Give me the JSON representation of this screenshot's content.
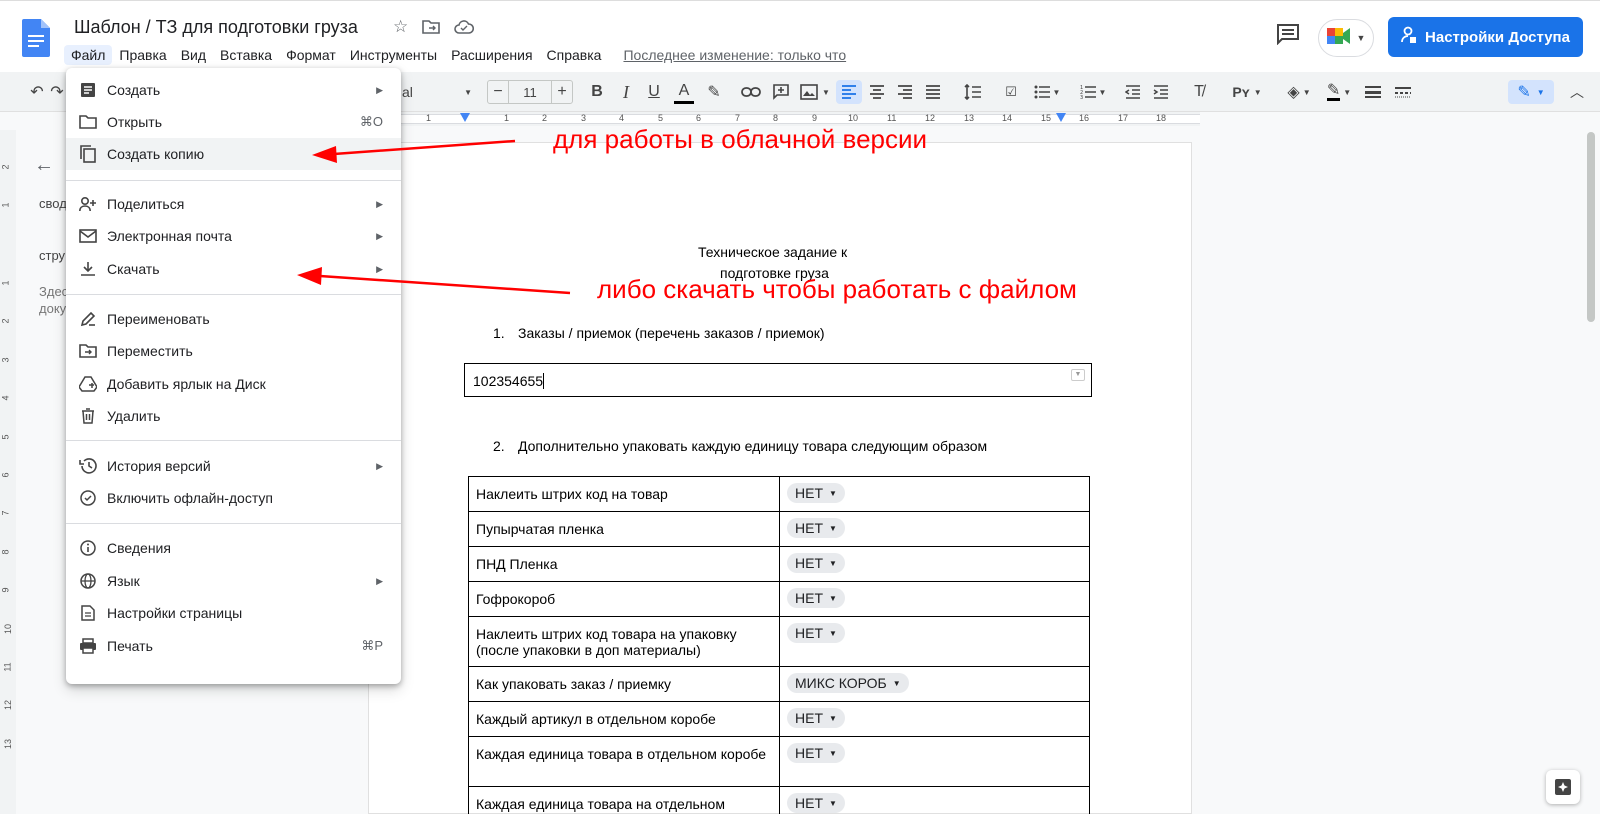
{
  "document": {
    "title": "Шаблон / ТЗ для подготовки груза"
  },
  "menubar": {
    "items": [
      "Файл",
      "Правка",
      "Вид",
      "Вставка",
      "Формат",
      "Инструменты",
      "Расширения",
      "Справка"
    ],
    "last_edit": "Последнее изменение: только что"
  },
  "header": {
    "share_label": "Настройки Доступа",
    "share_color": "#1a73e8"
  },
  "toolbar": {
    "font_name": "al",
    "font_size": "11",
    "minus": "−",
    "plus": "+"
  },
  "ruler": {
    "numbers": [
      "1",
      "1",
      "2",
      "3",
      "4",
      "5",
      "6",
      "7",
      "8",
      "9",
      "10",
      "11",
      "12",
      "13",
      "14",
      "15",
      "16",
      "17",
      "18"
    ]
  },
  "vertical_ruler": {
    "numbers": [
      "2",
      "1",
      "1",
      "2",
      "3",
      "4",
      "5",
      "6",
      "7",
      "8",
      "9",
      "10",
      "11",
      "12",
      "13"
    ]
  },
  "outline": {
    "lines": [
      "свод",
      "стру",
      "Здес",
      "доку"
    ]
  },
  "file_menu": {
    "items": [
      {
        "label": "Создать",
        "icon": "doc-icon",
        "submenu": true
      },
      {
        "label": "Открыть",
        "icon": "folder-icon",
        "shortcut": "⌘O"
      },
      {
        "label": "Создать копию",
        "icon": "copy-icon"
      },
      {
        "label": "Поделиться",
        "icon": "person-add-icon",
        "submenu": true
      },
      {
        "label": "Электронная почта",
        "icon": "mail-icon",
        "submenu": true
      },
      {
        "label": "Скачать",
        "icon": "download-icon",
        "submenu": true
      },
      {
        "label": "Переименовать",
        "icon": "rename-icon"
      },
      {
        "label": "Переместить",
        "icon": "move-icon"
      },
      {
        "label": "Добавить ярлык на Диск",
        "icon": "drive-shortcut-icon"
      },
      {
        "label": "Удалить",
        "icon": "trash-icon"
      },
      {
        "label": "История версий",
        "icon": "history-icon",
        "submenu": true
      },
      {
        "label": "Включить офлайн-доступ",
        "icon": "offline-icon"
      },
      {
        "label": "Сведения",
        "icon": "info-icon"
      },
      {
        "label": "Язык",
        "icon": "globe-icon",
        "submenu": true
      },
      {
        "label": "Настройки страницы",
        "icon": "page-setup-icon"
      },
      {
        "label": "Печать",
        "icon": "print-icon",
        "shortcut": "⌘P"
      }
    ]
  },
  "annotations": {
    "copy_note": "для работы в облачной версии",
    "download_note": "либо скачать чтобы работать с файлом",
    "color": "#ff0000"
  },
  "page": {
    "heading_line1": "Техническое задание к",
    "heading_line2": "подготовке груза",
    "section1_num": "1.",
    "section1_title": "Заказы / приемок (перечень заказов / приемок)",
    "order_number": "102354655",
    "section2_num": "2.",
    "section2_title": "Дополнительно упаковать каждую единицу товара  следующим образом",
    "table": [
      {
        "label": "Наклеить штрих код на товар",
        "value": "НЕТ"
      },
      {
        "label": "Пупырчатая пленка",
        "value": "НЕТ"
      },
      {
        "label": "ПНД Пленка",
        "value": "НЕТ"
      },
      {
        "label": "Гофрокороб",
        "value": "НЕТ"
      },
      {
        "label": "Наклеить штрих код товара на упаковку (после упаковки в доп материалы)",
        "value": "НЕТ"
      },
      {
        "label": "Как упаковать заказ / приемку",
        "value": "МИКС КОРОБ"
      },
      {
        "label": "Каждый артикул в отдельном коробе",
        "value": "НЕТ"
      },
      {
        "label": "Каждая единица товара в отдельном коробе",
        "value": "НЕТ"
      },
      {
        "label": "Каждая единица товара на отдельном",
        "value": "НЕТ"
      }
    ]
  }
}
